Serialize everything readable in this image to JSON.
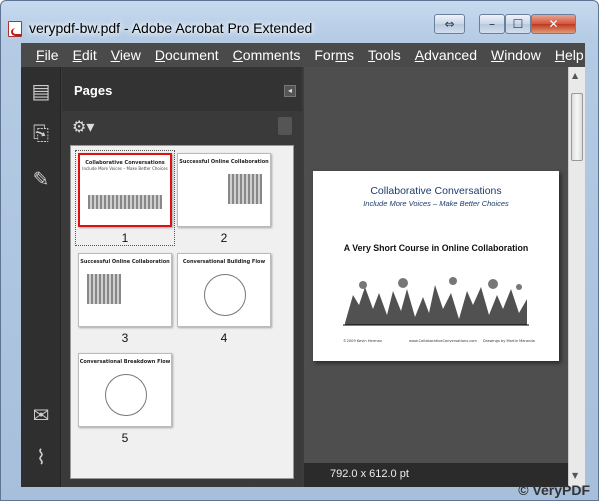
{
  "window": {
    "title": "verypdf-bw.pdf - Adobe Acrobat Pro Extended",
    "controls": {
      "restore": "⇔",
      "minimize": "–",
      "maximize": "☐",
      "close": "✕"
    }
  },
  "menubar": {
    "items": [
      {
        "key": "F",
        "rest": "ile"
      },
      {
        "key": "E",
        "rest": "dit"
      },
      {
        "key": "V",
        "rest": "iew"
      },
      {
        "key": "D",
        "rest": "ocument"
      },
      {
        "key": "C",
        "rest": "omments"
      },
      {
        "pre": "For",
        "key": "m",
        "rest": "s"
      },
      {
        "key": "T",
        "rest": "ools"
      },
      {
        "key": "A",
        "rest": "dvanced"
      },
      {
        "key": "W",
        "rest": "indow"
      },
      {
        "key": "H",
        "rest": "elp"
      }
    ]
  },
  "left_rail": {
    "icons": [
      "pages-icon",
      "bookmarks-icon",
      "signatures-icon",
      "comments-icon",
      "attachments-icon"
    ]
  },
  "pages_panel": {
    "title": "Pages",
    "thumbnails": [
      {
        "number": "1",
        "title": "Collaborative Conversations",
        "subtitle": "Include More Voices – Make Better Choices",
        "selected": true
      },
      {
        "number": "2",
        "title": "Successful Online Collaboration",
        "selected": false
      },
      {
        "number": "3",
        "title": "Successful Online Collaboration",
        "selected": false
      },
      {
        "number": "4",
        "title": "Conversational Building Flow",
        "selected": false
      },
      {
        "number": "5",
        "title": "Conversational Breakdown Flow",
        "selected": false
      }
    ]
  },
  "document": {
    "page": {
      "title": "Collaborative Conversations",
      "subtitle": "Include More Voices – Make Better Choices",
      "course": "A Very Short Course in Online Collaboration",
      "footer_left": "©2009 Kevin Herman",
      "footer_mid": "www.CollaborativeConversations.com",
      "footer_right": "Drawings by Martin Maranda"
    },
    "status": "792.0 x 612.0 pt"
  },
  "watermark": "© VeryPDF"
}
